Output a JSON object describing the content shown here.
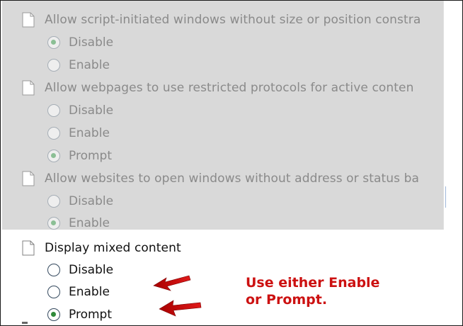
{
  "settings": [
    {
      "label": "Allow script-initiated windows without size or position constra",
      "state": "disabled",
      "options": [
        {
          "label": "Disable",
          "selected": true
        },
        {
          "label": "Enable",
          "selected": false
        }
      ]
    },
    {
      "label": "Allow webpages to use restricted protocols for active conten",
      "state": "disabled",
      "options": [
        {
          "label": "Disable",
          "selected": false
        },
        {
          "label": "Enable",
          "selected": false
        },
        {
          "label": "Prompt",
          "selected": true
        }
      ]
    },
    {
      "label": "Allow websites to open windows without address or status ba",
      "state": "disabled",
      "options": [
        {
          "label": "Disable",
          "selected": false
        },
        {
          "label": "Enable",
          "selected": true
        }
      ]
    },
    {
      "label": "Display mixed content",
      "state": "active",
      "options": [
        {
          "label": "Disable",
          "selected": false
        },
        {
          "label": "Enable",
          "selected": false
        },
        {
          "label": "Prompt",
          "selected": true
        }
      ]
    }
  ],
  "annotation": {
    "line1": "Use either Enable",
    "line2": "or Prompt.",
    "color": "#cc1111"
  },
  "icons": {
    "setting": "document-icon",
    "arrow": "red-arrow-icon"
  }
}
